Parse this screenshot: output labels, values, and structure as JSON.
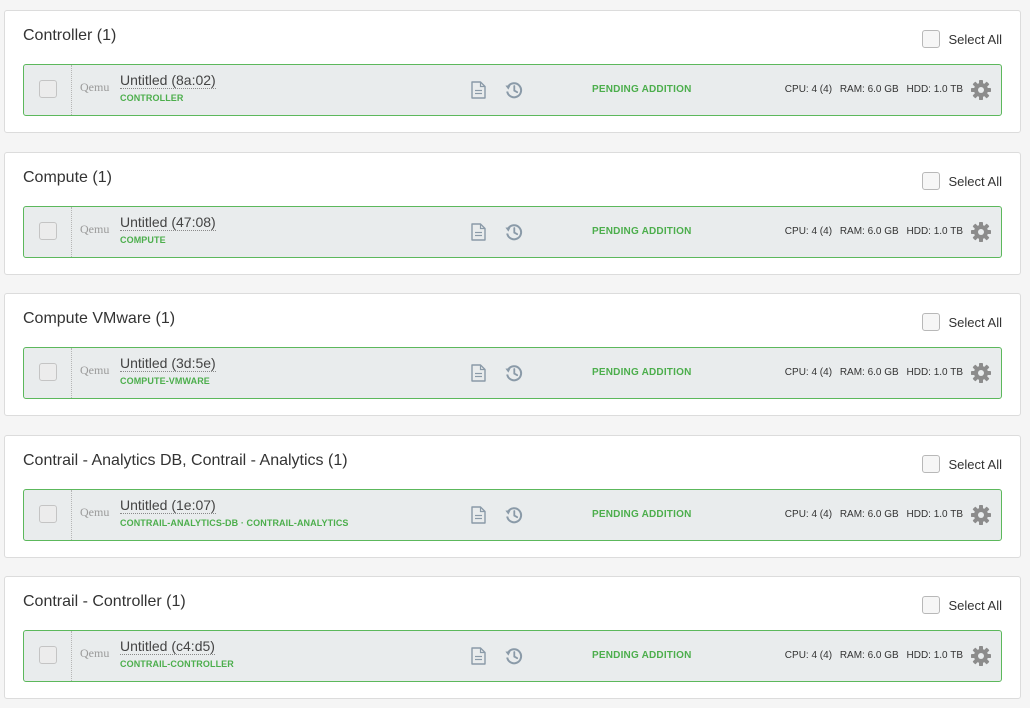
{
  "select_all_label": "Select All",
  "icons": {
    "details": "document-icon",
    "history": "history-icon",
    "settings": "gear-icon"
  },
  "colors": {
    "status_green": "#4cae4c",
    "row_border": "#5cb85c",
    "row_background": "#e9eced",
    "icon_gray_blue": "#8a9aa8",
    "gear_gray": "#8c8c8c"
  },
  "groups": [
    {
      "title": "Controller (1)",
      "node": {
        "manufacturer": "Qemu",
        "name": "Untitled (8a:02)",
        "roles": "CONTROLLER",
        "status": "PENDING ADDITION",
        "cpu": "CPU: 4 (4)",
        "ram": "RAM: 6.0 GB",
        "hdd": "HDD: 1.0 TB"
      }
    },
    {
      "title": "Compute (1)",
      "node": {
        "manufacturer": "Qemu",
        "name": "Untitled (47:08)",
        "roles": "COMPUTE",
        "status": "PENDING ADDITION",
        "cpu": "CPU: 4 (4)",
        "ram": "RAM: 6.0 GB",
        "hdd": "HDD: 1.0 TB"
      }
    },
    {
      "title": "Compute VMware (1)",
      "node": {
        "manufacturer": "Qemu",
        "name": "Untitled (3d:5e)",
        "roles": "COMPUTE-VMWARE",
        "status": "PENDING ADDITION",
        "cpu": "CPU: 4 (4)",
        "ram": "RAM: 6.0 GB",
        "hdd": "HDD: 1.0 TB"
      }
    },
    {
      "title": "Contrail - Analytics DB, Contrail - Analytics (1)",
      "node": {
        "manufacturer": "Qemu",
        "name": "Untitled (1e:07)",
        "roles": "CONTRAIL-ANALYTICS-DB · CONTRAIL-ANALYTICS",
        "status": "PENDING ADDITION",
        "cpu": "CPU: 4 (4)",
        "ram": "RAM: 6.0 GB",
        "hdd": "HDD: 1.0 TB"
      }
    },
    {
      "title": "Contrail - Controller (1)",
      "node": {
        "manufacturer": "Qemu",
        "name": "Untitled (c4:d5)",
        "roles": "CONTRAIL-CONTROLLER",
        "status": "PENDING ADDITION",
        "cpu": "CPU: 4 (4)",
        "ram": "RAM: 6.0 GB",
        "hdd": "HDD: 1.0 TB"
      }
    }
  ]
}
